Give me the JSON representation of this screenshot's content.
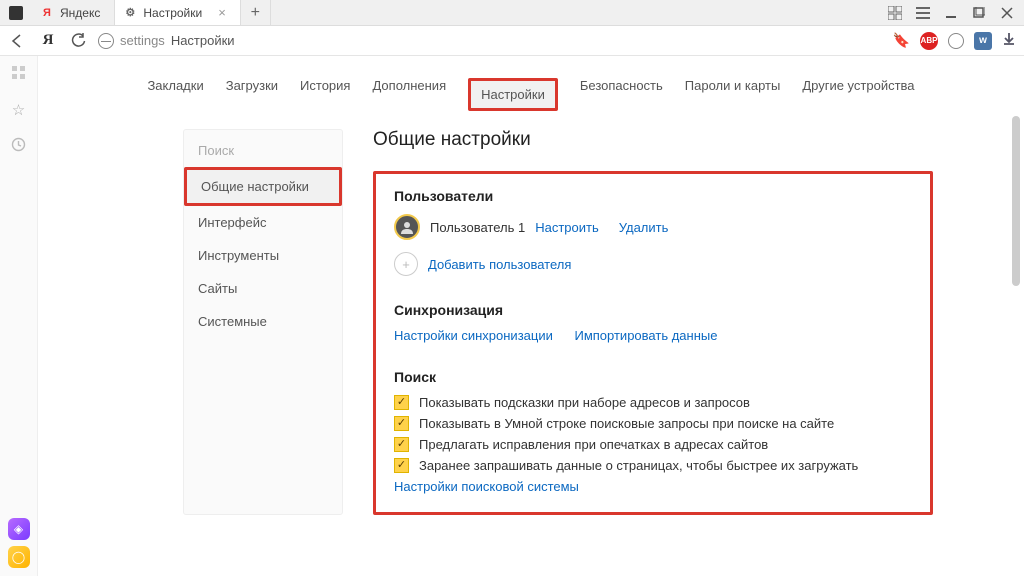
{
  "titlebar": {
    "tabs": [
      {
        "favicon_letter": "Я",
        "favicon_color": "#e33",
        "label": "Яндекс"
      },
      {
        "favicon_glyph": "⚙",
        "label": "Настройки"
      }
    ]
  },
  "addressbar": {
    "url_prefix": "settings",
    "url_rest": "Настройки"
  },
  "topnav": {
    "items": [
      "Закладки",
      "Загрузки",
      "История",
      "Дополнения",
      "Настройки",
      "Безопасность",
      "Пароли и карты",
      "Другие устройства"
    ],
    "active_index": 4
  },
  "sidebar": {
    "items": [
      {
        "label": "Поиск",
        "muted": true
      },
      {
        "label": "Общие настройки",
        "active": true
      },
      {
        "label": "Интерфейс"
      },
      {
        "label": "Инструменты"
      },
      {
        "label": "Сайты"
      },
      {
        "label": "Системные"
      }
    ]
  },
  "panel": {
    "heading": "Общие настройки",
    "users": {
      "title": "Пользователи",
      "user1": "Пользователь 1",
      "configure": "Настроить",
      "delete": "Удалить",
      "add": "Добавить пользователя"
    },
    "sync": {
      "title": "Синхронизация",
      "settings": "Настройки синхронизации",
      "import": "Импортировать данные"
    },
    "search": {
      "title": "Поиск",
      "opts": [
        "Показывать подсказки при наборе адресов и запросов",
        "Показывать в Умной строке поисковые запросы при поиске на сайте",
        "Предлагать исправления при опечатках в адресах сайтов",
        "Заранее запрашивать данные о страницах, чтобы быстрее их загружать"
      ],
      "engine_link": "Настройки поисковой системы"
    }
  }
}
